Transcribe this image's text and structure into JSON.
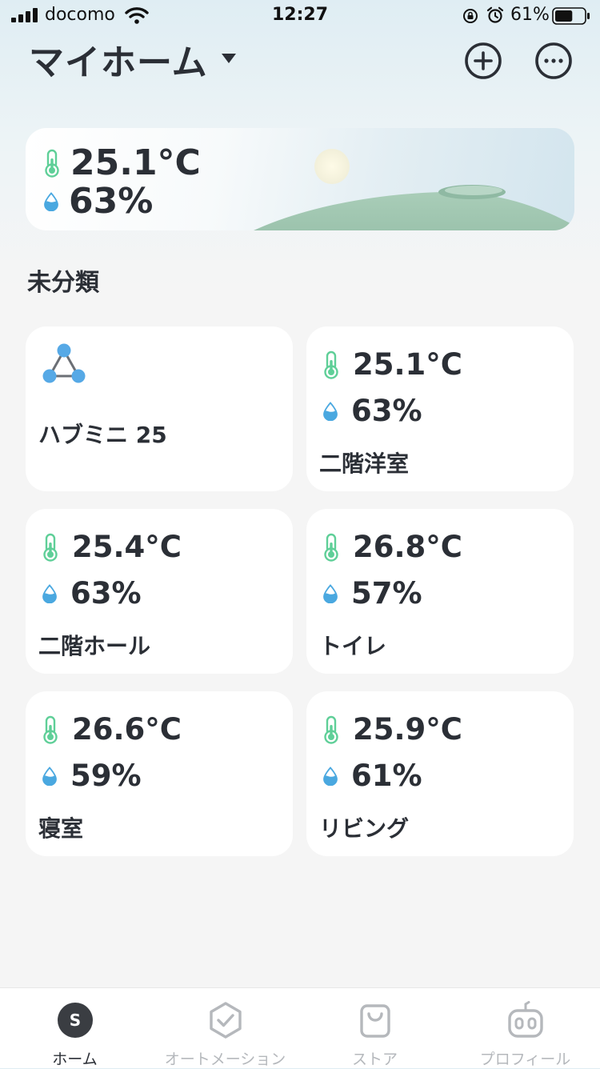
{
  "status_bar": {
    "carrier": "docomo",
    "time": "12:27",
    "battery_percent": "61%",
    "battery_level": 0.61
  },
  "header": {
    "title": "マイホーム"
  },
  "summary": {
    "temperature": "25.1°C",
    "humidity": "63%"
  },
  "section": {
    "title": "未分類"
  },
  "hub": {
    "name": "ハブミニ 25"
  },
  "devices": [
    {
      "temperature": "25.1°C",
      "humidity": "63%",
      "name": "二階洋室"
    },
    {
      "temperature": "25.4°C",
      "humidity": "63%",
      "name": "二階ホール"
    },
    {
      "temperature": "26.8°C",
      "humidity": "57%",
      "name": "トイレ"
    },
    {
      "temperature": "26.6°C",
      "humidity": "59%",
      "name": "寝室"
    },
    {
      "temperature": "25.9°C",
      "humidity": "61%",
      "name": "リビング"
    }
  ],
  "tabs": [
    {
      "label": "ホーム",
      "icon": "home-s-icon",
      "active": true
    },
    {
      "label": "オートメーション",
      "icon": "automation-hexagon-check-icon",
      "active": false
    },
    {
      "label": "ストア",
      "icon": "store-bag-icon",
      "active": false
    },
    {
      "label": "プロフィール",
      "icon": "robot-profile-icon",
      "active": false
    }
  ],
  "home_tab_letter": "S",
  "colors": {
    "text": "#2b2f36",
    "thermometer": "#5fcf98",
    "humidity": "#4aa8e0",
    "hub": "#56a9e6",
    "tab_inactive": "#b5b8bc",
    "tab_active": "#3a3d42"
  }
}
